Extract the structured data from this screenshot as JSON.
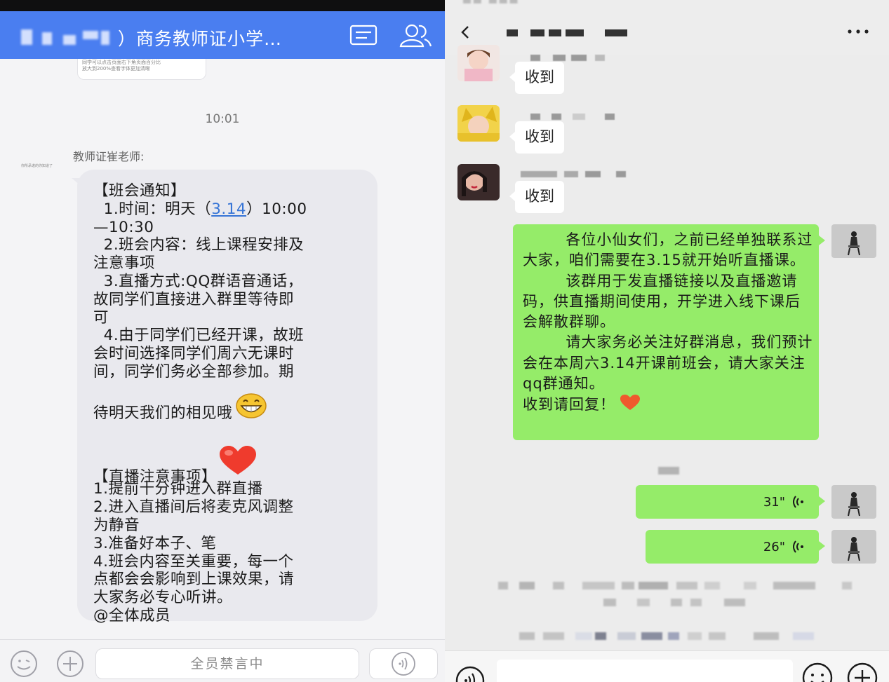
{
  "left_panel": {
    "header": {
      "group_title": "）商务教师证小学…"
    },
    "preview_card": {
      "line1": "同学可以点击页面右下角页面百分比",
      "line2": "放大到200%查看字体更加清晰"
    },
    "timestamp": "10:01",
    "message": {
      "sender": "教师证崔老师:",
      "avatar_caption": "你所承诺的你知道了",
      "line_01": "【班会通知】",
      "line_02a": "  1.时间：明天（",
      "line_02_link": "3.14",
      "line_02b": "）10:00",
      "line_03": "—10:30",
      "line_04": "  2.班会内容：线上课程安排及",
      "line_05": "注意事项",
      "line_06": "  3.直播方式:QQ群语音通话，",
      "line_07": "故同学们直接进入群里等待即",
      "line_08": "可",
      "line_09": "  4.由于同学们已经开课，故班",
      "line_10": "会时间选择同学们周六无课时",
      "line_11": "间，同学们务必全部参加。期",
      "line_12": "待明天我们的相见哦",
      "line_13": "【直播注意事项】",
      "line_14": "1.提前十分钟进入群直播",
      "line_15": "2.进入直播间后将麦克风调整",
      "line_16": "为静音",
      "line_17": "3.准备好本子、笔",
      "line_18": "4.班会内容至关重要，每一个",
      "line_19": "点都会会影响到上课效果，请",
      "line_20": "大家务必专心听讲。",
      "line_21": "@全体成员"
    },
    "input_bar": {
      "muted_text": "全员禁言中"
    }
  },
  "right_panel": {
    "chat_header": {
      "back_icon": "chevron-left-icon",
      "more_icon": "more-dots-icon"
    },
    "incoming": [
      {
        "text": "收到"
      },
      {
        "text": "收到"
      },
      {
        "text": "收到"
      }
    ],
    "announcement": {
      "para1": "        各位小仙女们，之前已经单独联系过大家，咱们需要在3.15就开始听直播课。",
      "para2": "        该群用于发直播链接以及直播邀请码，供直播期间使用，开学进入线下课后会解散群聊。",
      "para3": "        请大家务必关注好群消息，我们预计会在本周六3.14开课前班会，请大家关注qq群通知。",
      "para4": "收到请回复！"
    },
    "voice_messages": [
      {
        "duration": "31\""
      },
      {
        "duration": "26\""
      }
    ]
  },
  "colors": {
    "qq_blue": "#4a7ef0",
    "wechat_green": "#95ec69",
    "heart_red": "#ef3b2d"
  }
}
